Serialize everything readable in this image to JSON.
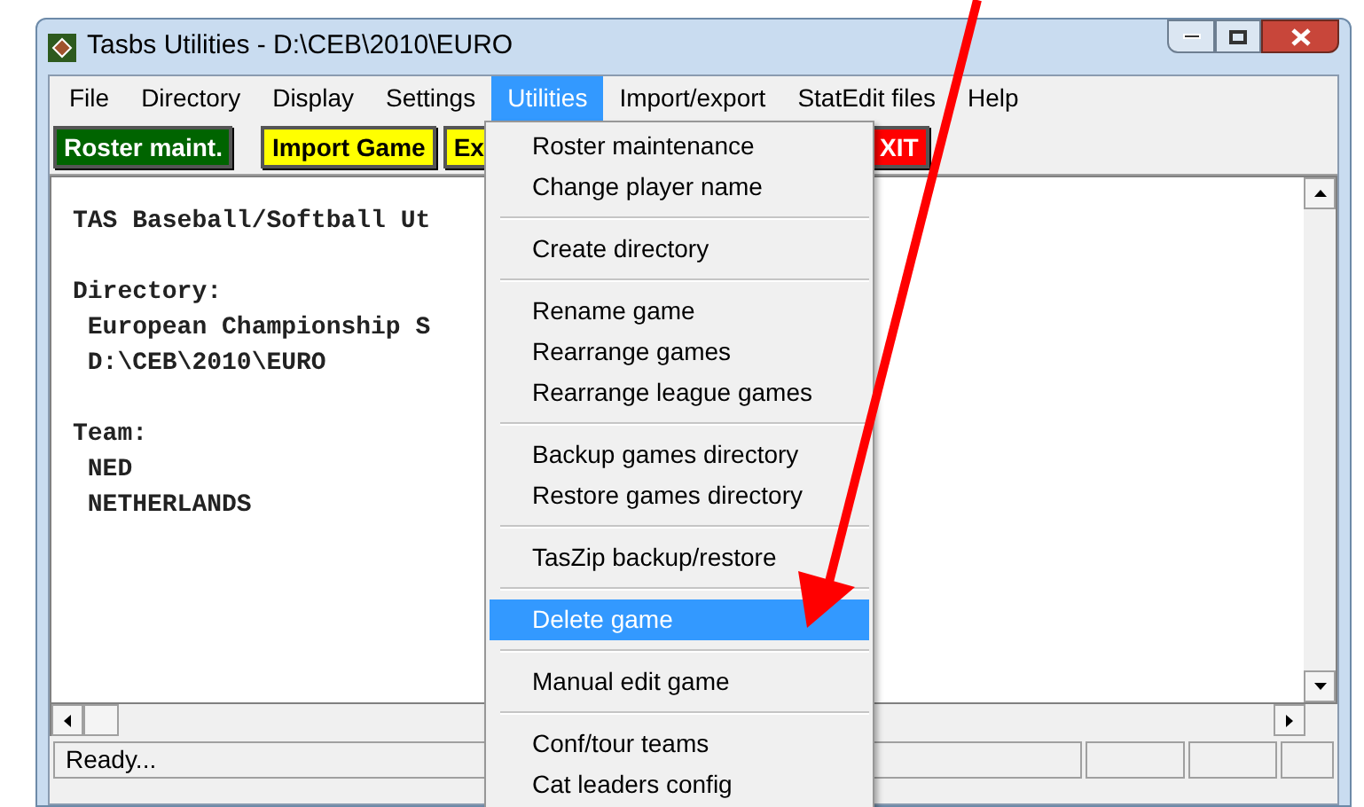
{
  "window": {
    "title": "Tasbs Utilities - D:\\CEB\\2010\\EURO"
  },
  "menu_bar": [
    {
      "label": "File",
      "selected": false
    },
    {
      "label": "Directory",
      "selected": false
    },
    {
      "label": "Display",
      "selected": false
    },
    {
      "label": "Settings",
      "selected": false
    },
    {
      "label": "Utilities",
      "selected": true
    },
    {
      "label": "Import/export",
      "selected": false
    },
    {
      "label": "StatEdit files",
      "selected": false
    },
    {
      "label": "Help",
      "selected": false
    }
  ],
  "toolbar": [
    {
      "label": "Roster maint.",
      "color": "#006400"
    },
    {
      "label": "Import Game",
      "color": "#ffff00"
    },
    {
      "label": "Ex",
      "color": "#ffff00"
    },
    {
      "label": "XIT",
      "color": "#ff0000"
    }
  ],
  "document_sections": [
    [
      "TAS Baseball/Softball Ut"
    ],
    [
      "Directory:",
      " European Championship S",
      " D:\\CEB\\2010\\EURO"
    ],
    [
      "Team:",
      " NED",
      " NETHERLANDS"
    ]
  ],
  "utilities_menu": [
    {
      "kind": "item",
      "label": "Roster maintenance",
      "selected": false
    },
    {
      "kind": "item",
      "label": "Change player name",
      "selected": false
    },
    {
      "kind": "separator"
    },
    {
      "kind": "item",
      "label": "Create directory",
      "selected": false
    },
    {
      "kind": "separator"
    },
    {
      "kind": "item",
      "label": "Rename game",
      "selected": false
    },
    {
      "kind": "item",
      "label": "Rearrange games",
      "selected": false
    },
    {
      "kind": "item",
      "label": "Rearrange league games",
      "selected": false
    },
    {
      "kind": "separator"
    },
    {
      "kind": "item",
      "label": "Backup games directory",
      "selected": false
    },
    {
      "kind": "item",
      "label": "Restore games directory",
      "selected": false
    },
    {
      "kind": "separator"
    },
    {
      "kind": "item",
      "label": "TasZip backup/restore",
      "selected": false
    },
    {
      "kind": "separator"
    },
    {
      "kind": "item",
      "label": "Delete game",
      "selected": true
    },
    {
      "kind": "separator"
    },
    {
      "kind": "item",
      "label": "Manual edit game",
      "selected": false
    },
    {
      "kind": "separator"
    },
    {
      "kind": "item",
      "label": "Conf/tour teams",
      "selected": false
    },
    {
      "kind": "item",
      "label": "Cat leaders config",
      "selected": false
    }
  ],
  "status_bar": {
    "text": "Ready..."
  }
}
